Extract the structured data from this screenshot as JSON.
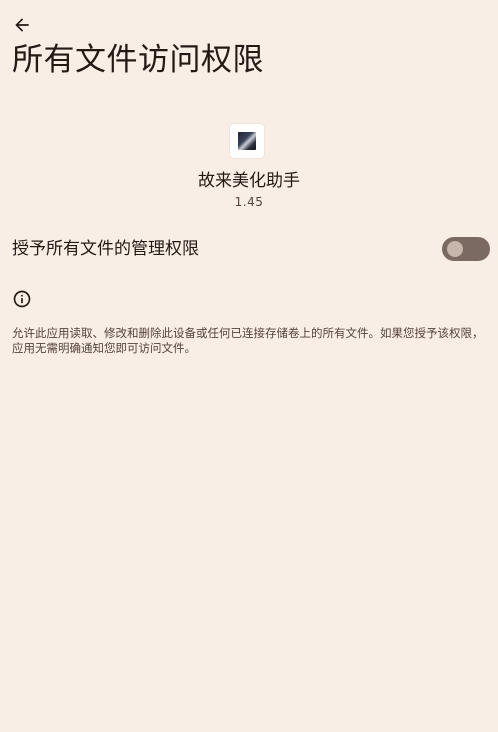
{
  "header": {
    "title": "所有文件访问权限"
  },
  "app": {
    "name": "故来美化助手",
    "version": "1.45"
  },
  "permission": {
    "label": "授予所有文件的管理权限",
    "enabled": false
  },
  "info": {
    "text": "允许此应用读取、修改和删除此设备或任何已连接存储卷上的所有文件。如果您授予该权限，应用无需明确通知您即可访问文件。"
  },
  "icons": {
    "back": "arrow-back-icon",
    "info": "info-icon"
  },
  "colors": {
    "background": "#F9EEE6",
    "switch_track": "#7A6A61",
    "switch_thumb": "#C6B6AC"
  }
}
